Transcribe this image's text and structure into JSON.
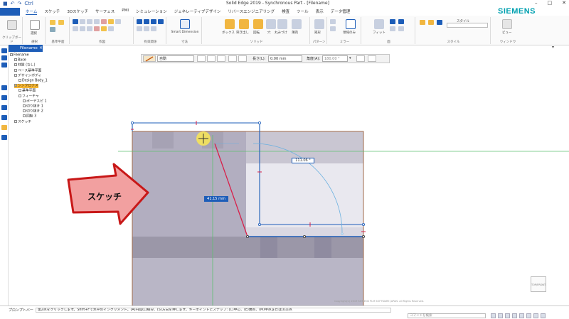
{
  "app": {
    "title": "Solid Edge 2019 - Synchronous Part - [Filename]",
    "brand": "SIEMENS",
    "qat_glyph": "Ctrl"
  },
  "menu": {
    "tabs": [
      "ホーム",
      "スケッチ",
      "3Dスケッチ",
      "サーフェス",
      "PMI",
      "シミュレーション",
      "ジェネレーティブデザイン",
      "リバースエンジニアリング",
      "検査",
      "ツール",
      "表示",
      "データ管理"
    ],
    "active_tab": "ホーム"
  },
  "ribbon": {
    "groups": [
      {
        "label": "クリップボード"
      },
      {
        "label": "選択"
      },
      {
        "label": "基準平面"
      },
      {
        "label": "作図"
      },
      {
        "label": "拘束関係"
      },
      {
        "label": "寸法"
      },
      {
        "label": "ソリッド"
      },
      {
        "label": "パターン"
      },
      {
        "label": "ミラー"
      },
      {
        "label": "面"
      },
      {
        "label": "スタイル"
      },
      {
        "label": "ウィンドウ"
      }
    ],
    "items": {
      "select": "選択",
      "smart_dimension": "Smart Dimension",
      "box": "ボックス",
      "extrude": "突き出し",
      "revolve": "回転",
      "hole": "穴",
      "round": "丸みづけ",
      "thin": "薄肉",
      "pattern": "矩形",
      "sketch_region": "領域のみ",
      "fit": "フィット",
      "style": "スタイル",
      "views": "ビュー"
    }
  },
  "doc_tab": {
    "label": "Filename"
  },
  "tree": {
    "items": [
      {
        "label": "Filename",
        "level": 0
      },
      {
        "label": "Base",
        "level": 1
      },
      {
        "label": "材質 (なし)",
        "level": 1
      },
      {
        "label": "ベース基準平面",
        "level": 1
      },
      {
        "label": "デザインボディ",
        "level": 1
      },
      {
        "label": "Design Body_1",
        "level": 2
      },
      {
        "label": "シンクロナス",
        "level": 1
      },
      {
        "label": "基準平面",
        "level": 2
      },
      {
        "label": "フィーチャ",
        "level": 2
      },
      {
        "label": "ポーデスピ 1",
        "level": 3
      },
      {
        "label": "切り抜き 1",
        "level": 3
      },
      {
        "label": "切り抜き 2",
        "level": 3
      },
      {
        "label": "回転 3",
        "level": 3
      },
      {
        "label": "スケッチ",
        "level": 1
      }
    ],
    "highlight_index": 6
  },
  "command_bar": {
    "mode": "自動",
    "length_label": "長さ(L):",
    "length_value": "0.00 mm",
    "angle_label": "角度(A):",
    "angle_value": "180.00 °"
  },
  "canvas": {
    "dim_angle": "111.06 °",
    "dim_length": "41.15 mm",
    "callout": "スケッチ",
    "view_badge": "TOP/FRONT",
    "copyright": "Copyright(C) 2019 SIEMENS PLM SOFTWARE JAPAN. All Rights Reserved."
  },
  "status": {
    "prompt_label": "プロンプトバー",
    "prompt_text": "第2点をクリックします。Shift+Fで水平のインクリメント。(A)円弧(L)線分、(S)方向を押します。キーポイントにスナップ: (C)中心、(E)端点、(M)中点または(I)交点",
    "search_placeholder": "コマンドを検索"
  },
  "colors": {
    "accent": "#1d5db8",
    "brand": "#00a0b0",
    "sketch_line": "#1d5db8",
    "callout_fill": "#f2a0a0",
    "callout_border": "#c81818"
  }
}
